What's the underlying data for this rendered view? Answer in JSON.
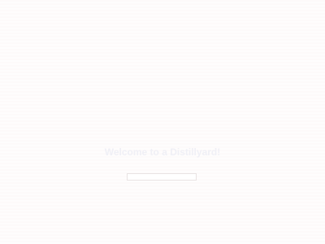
{
  "header": {
    "title": "",
    "tagline": ""
  },
  "nav": {
    "link_label": ""
  },
  "main": {
    "section_label": "",
    "welcome_heading": "Welcome to a Distillyard!",
    "corner_label": "",
    "search_left_label": "",
    "search_value": "",
    "search_placeholder": "",
    "search_right_label": ""
  },
  "colors": {
    "accent": "#f2dede",
    "heading": "#f0f0f6",
    "background": "#fdfafa"
  }
}
